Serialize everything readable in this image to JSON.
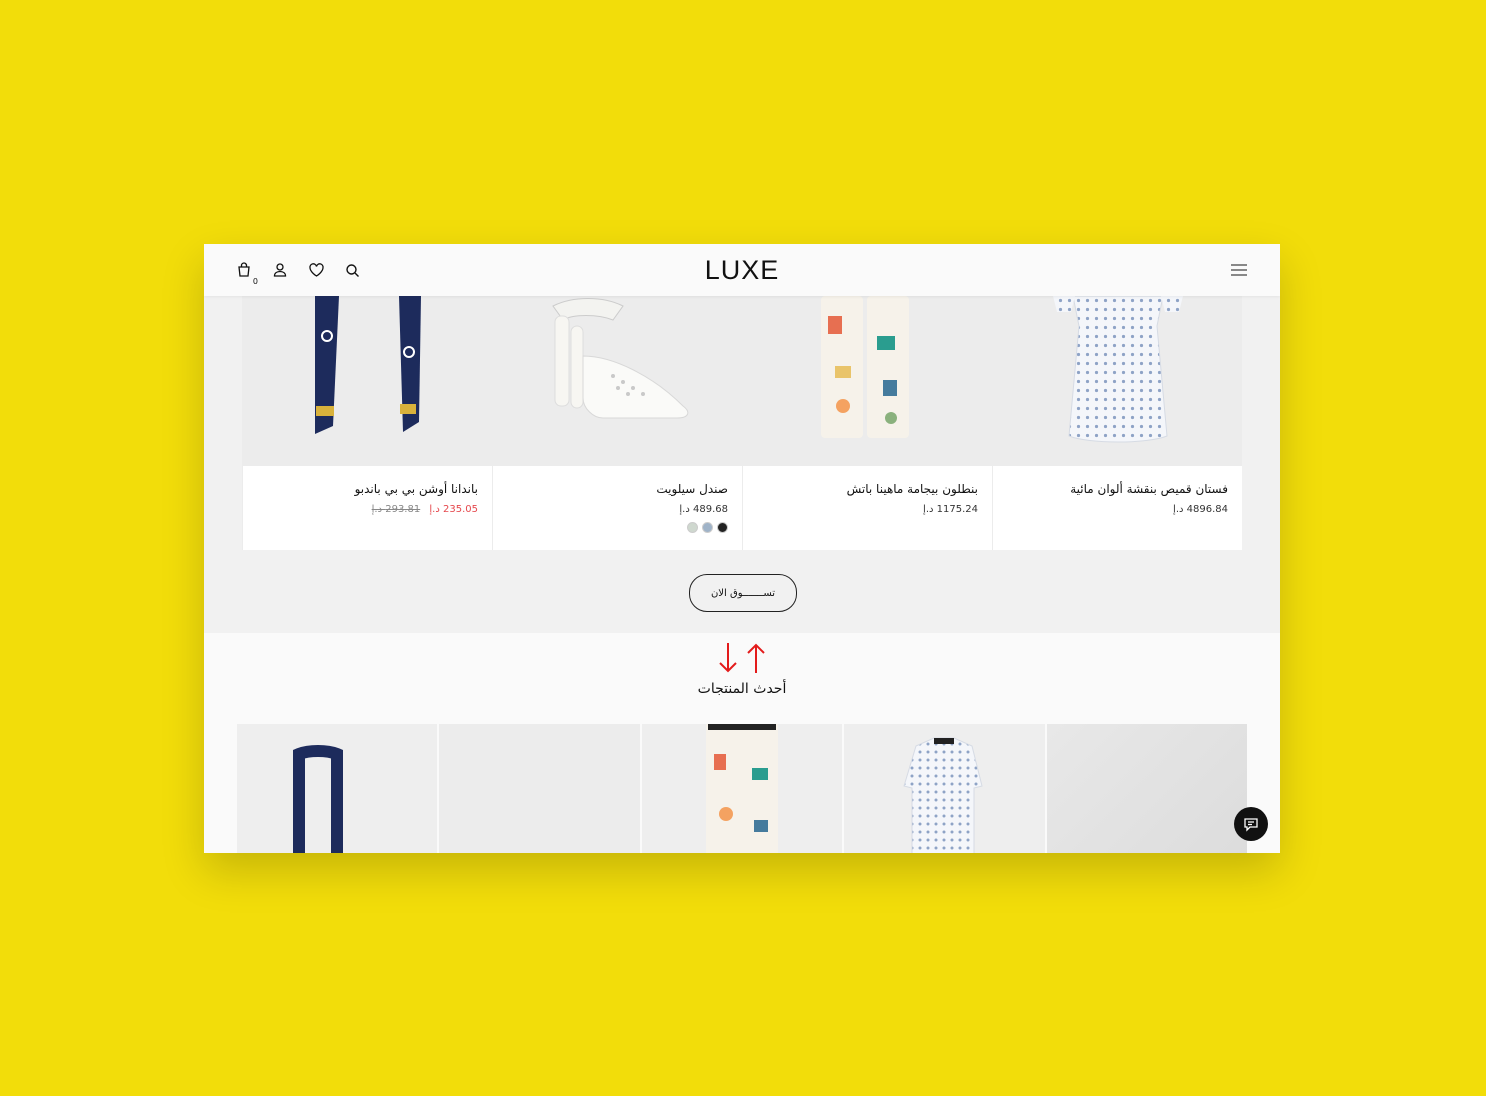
{
  "header": {
    "logo": "LUXE",
    "cart_count": "0"
  },
  "products": [
    {
      "name": "فستان قميص بنقشة ألوان مائية",
      "price": "4896.84 د.إ"
    },
    {
      "name": "بنطلون بيجامة ماهينا باتش",
      "price": "1175.24 د.إ"
    },
    {
      "name": "صندل سيلويت",
      "price": "489.68 د.إ",
      "swatches": [
        "#222222",
        "#9fb3c8",
        "#cfd8cf"
      ]
    },
    {
      "name": "باندانا أوشن بي بي باندبو",
      "sale_price": "235.05 د.إ",
      "old_price": "293.81 د.إ"
    }
  ],
  "shop_now_label": "تســـــــوق الان",
  "latest_title": "أحدث المنتجات",
  "colors": {
    "background": "#f2dd0a",
    "sale": "#e5484d",
    "arrow": "#e31b1b"
  }
}
